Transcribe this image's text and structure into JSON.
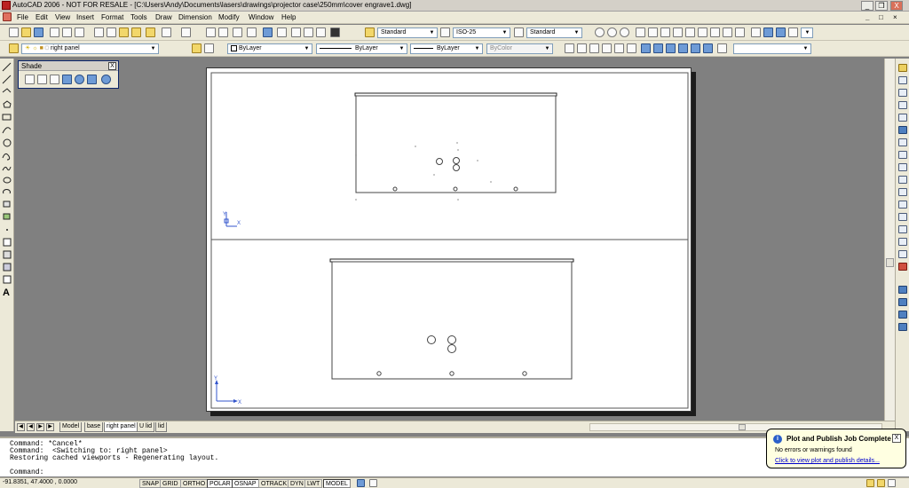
{
  "window": {
    "title": "AutoCAD 2006 - NOT FOR RESALE - [C:\\Users\\Andy\\Documents\\lasers\\drawings\\projector case\\250mm\\cover engrave1.dwg]",
    "minimize": "_",
    "restore": "❒",
    "close": "X"
  },
  "menu": [
    "File",
    "Edit",
    "View",
    "Insert",
    "Format",
    "Tools",
    "Draw",
    "Dimension",
    "Modify",
    "Window",
    "Help"
  ],
  "styles_toolbar": {
    "text_style": "Standard",
    "dim_style": "ISO-25",
    "table_style": "Standard"
  },
  "layers_toolbar": {
    "current_layer": "right panel"
  },
  "properties_toolbar": {
    "color": "ByLayer",
    "linetype": "ByLayer",
    "lineweight": "ByLayer",
    "plot_style": "ByColor"
  },
  "shade_toolbar": {
    "title": "Shade",
    "close": "X"
  },
  "draw_toolbar_text_tool": "A",
  "ucs": {
    "x": "X",
    "y": "Y"
  },
  "layout_tabs": {
    "tabs": [
      "Model",
      "base",
      "right panel",
      "U lid",
      "lid"
    ],
    "active": "right panel"
  },
  "command_line": {
    "history": [
      "Command: *Cancel*",
      "Command:  <Switching to: right panel>",
      "Restoring cached viewports - Regenerating layout."
    ],
    "prompt": "Command:"
  },
  "status": {
    "coordinates": "-91.8351, 47.4000 , 0.0000",
    "toggles": [
      "SNAP",
      "GRID",
      "ORTHO",
      "POLAR",
      "OSNAP",
      "OTRACK",
      "DYN",
      "LWT",
      "MODEL"
    ],
    "on_toggles": [
      "POLAR",
      "OSNAP",
      "MODEL"
    ]
  },
  "notification": {
    "title": "Plot and Publish Job Complete",
    "message": "No errors or warnings found",
    "link": "Click to view plot and publish details...",
    "close": "X"
  },
  "colors": {
    "chrome": "#ece9d8",
    "drawing_bg": "#808080",
    "paper": "#ffffff",
    "balloon": "#ffffe1",
    "link": "#0000cc"
  }
}
